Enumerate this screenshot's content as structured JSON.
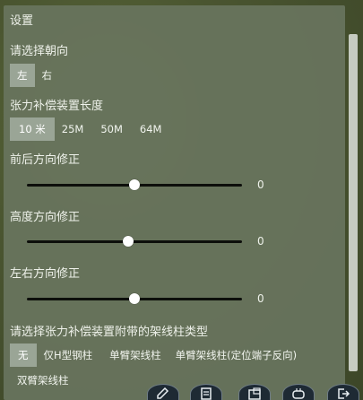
{
  "panel": {
    "title": "设置"
  },
  "orientation": {
    "label": "请选择朝向",
    "options": [
      "左",
      "右"
    ],
    "selected": 0
  },
  "length": {
    "label": "张力补偿装置长度",
    "options": [
      "10 米",
      "25M",
      "50M",
      "64M"
    ],
    "selected": 0
  },
  "front_back": {
    "label": "前后方向修正",
    "value": "0",
    "level": 0.5
  },
  "height": {
    "label": "高度方向修正",
    "value": "0",
    "level": 0.47
  },
  "left_right": {
    "label": "左右方向修正",
    "value": "0",
    "level": 0.5
  },
  "pole_type": {
    "label": "请选择张力补偿装置附带的架线柱类型",
    "options": [
      "无",
      "仅H型钢柱",
      "单臂架线柱",
      "单臂架线柱(定位端子反向)",
      "双臂架线柱"
    ],
    "selected": 0
  },
  "taskbar": {
    "icons": [
      "edit-icon",
      "document-icon",
      "window-icon",
      "gamepad-icon",
      "exit-icon"
    ]
  }
}
